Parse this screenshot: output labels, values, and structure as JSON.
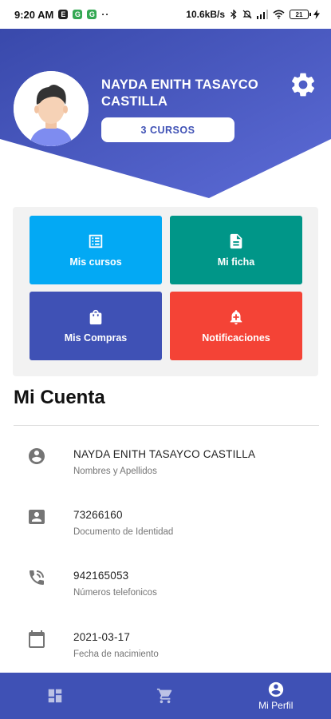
{
  "status_bar": {
    "time": "9:20 AM",
    "network_speed": "10.6kB/s",
    "battery": "21"
  },
  "colors": {
    "primary": "#3f51b5",
    "tile_cursos": "#03a9f4",
    "tile_ficha": "#009688",
    "tile_compras": "#3f51b5",
    "tile_notificaciones": "#f44336"
  },
  "profile": {
    "name": "NAYDA ENITH TASAYCO CASTILLA",
    "courses_button": "3 CURSOS"
  },
  "tiles": [
    {
      "label": "Mis cursos",
      "icon": "list-box-icon"
    },
    {
      "label": "Mi ficha",
      "icon": "document-icon"
    },
    {
      "label": "Mis Compras",
      "icon": "shopping-bag-icon"
    },
    {
      "label": "Notificaciones",
      "icon": "bell-plus-icon"
    }
  ],
  "account": {
    "title": "Mi Cuenta",
    "rows": [
      {
        "value": "NAYDA ENITH TASAYCO CASTILLA",
        "label": "Nombres y Apellidos",
        "icon": "account-circle-icon"
      },
      {
        "value": "73266160",
        "label": "Documento de Identidad",
        "icon": "id-card-icon"
      },
      {
        "value": "942165053",
        "label": "Números telefonicos",
        "icon": "phone-icon"
      },
      {
        "value": "2021-03-17",
        "label": "Fecha de nacimiento",
        "icon": "calendar-icon"
      }
    ]
  },
  "bottom_nav": [
    {
      "label": "",
      "icon": "dashboard-icon"
    },
    {
      "label": "",
      "icon": "cart-icon"
    },
    {
      "label": "Mi Perfil",
      "icon": "account-circle-icon"
    }
  ]
}
